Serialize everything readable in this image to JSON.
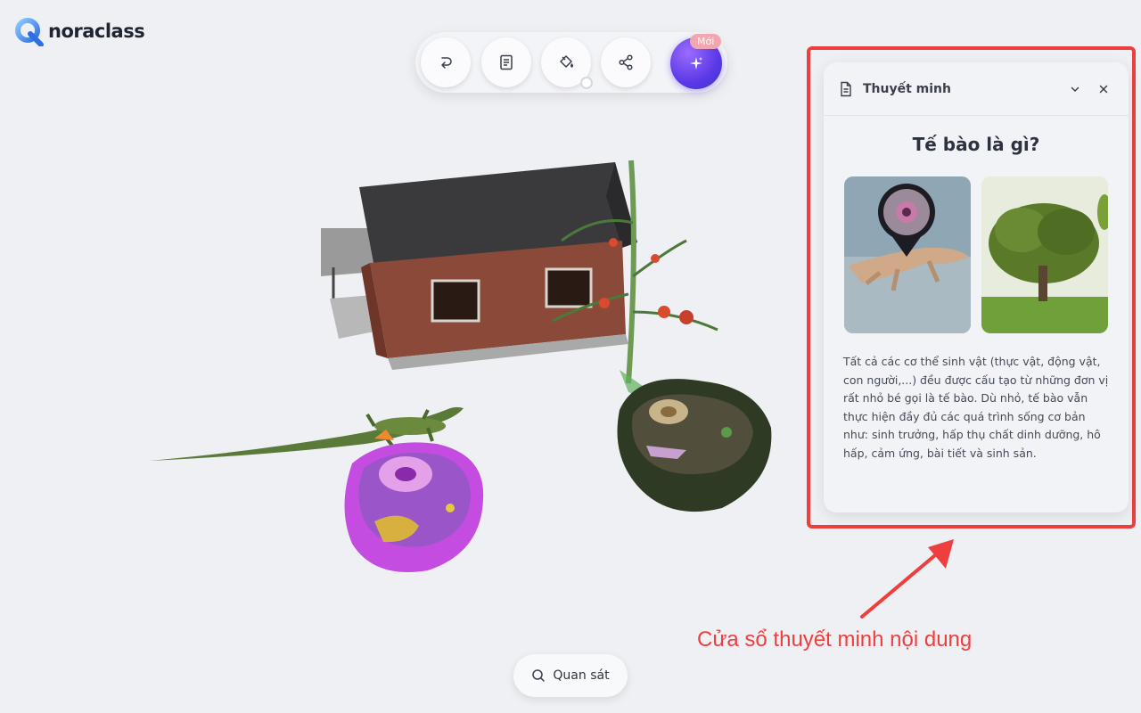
{
  "brand": {
    "name": "noraclass"
  },
  "toolbar": {
    "buttons": [
      {
        "name": "undo-icon"
      },
      {
        "name": "document-icon"
      },
      {
        "name": "paint-bucket-icon"
      },
      {
        "name": "share-icon"
      },
      {
        "name": "sparkle-icon"
      }
    ],
    "new_badge": "Mới"
  },
  "narration_panel": {
    "title": "Thuyết minh",
    "heading": "Tế bào là gì?",
    "body": "Tất cả các cơ thể sinh vật (thực vật, động vật, con người,...) đều được cấu tạo từ những đơn vị rất nhỏ bé gọi là tế bào. Dù nhỏ, tế bào vẫn thực hiện đầy đủ các quá trình sống cơ bản như: sinh trưởng, hấp thụ chất dinh dưỡng, hô hấp, cảm ứng, bài tiết và sinh sản."
  },
  "annotation": {
    "text": "Cửa sổ thuyết minh nội dung",
    "color": "#ee3e3e"
  },
  "observe": {
    "label": "Quan sát"
  },
  "colors": {
    "accent": "#5b39e6",
    "background": "#eff0f4",
    "highlight": "#ee3e3e"
  }
}
